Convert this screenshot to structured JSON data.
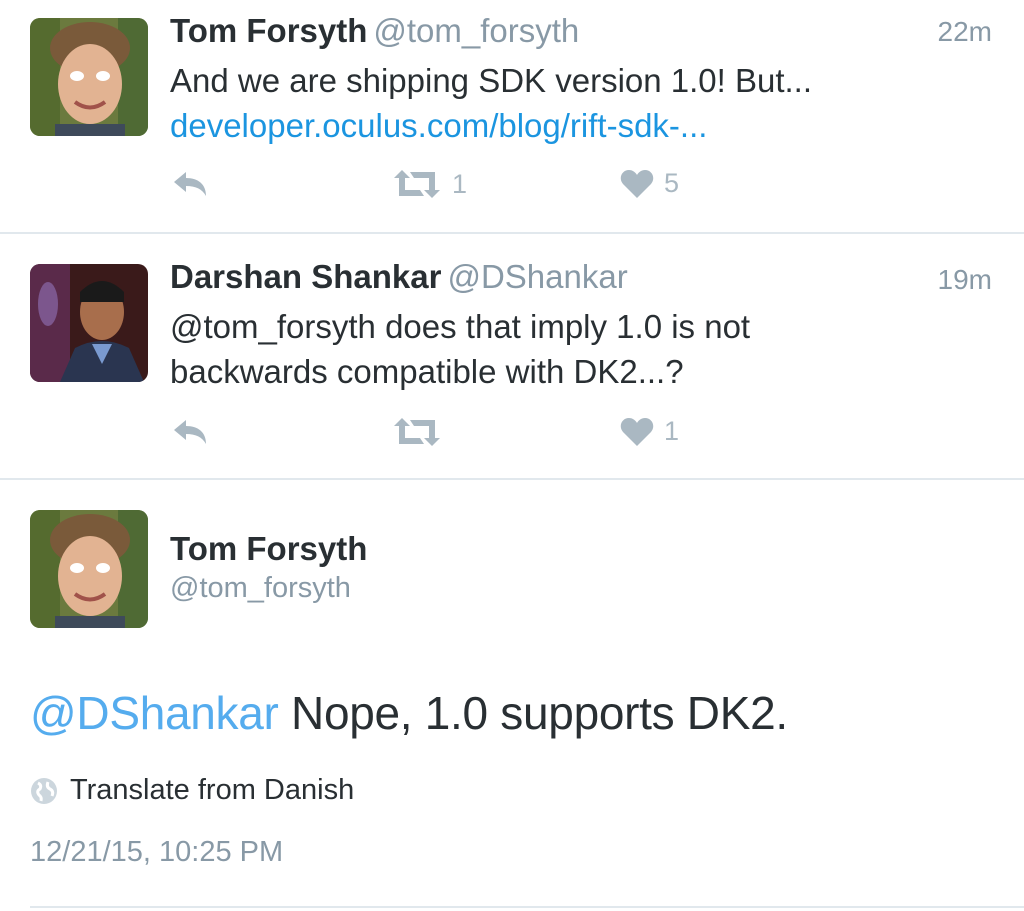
{
  "tweets": [
    {
      "name": "Tom Forsyth",
      "handle": "@tom_forsyth",
      "time": "22m",
      "text": "And we are shipping SDK version 1.0! But...",
      "link": "developer.oculus.com/blog/rift-sdk-...",
      "retweets": "1",
      "likes": "5",
      "avatar_icon": "person-photo"
    },
    {
      "name": "Darshan Shankar",
      "handle": "@DShankar",
      "time": "19m",
      "text_line1": "@tom_forsyth does that imply 1.0 is not",
      "text_line2": "backwards compatible with DK2...?",
      "retweets": "",
      "likes": "1",
      "avatar_icon": "person-photo"
    }
  ],
  "main_tweet": {
    "name": "Tom Forsyth",
    "handle": "@tom_forsyth",
    "mention": "@DShankar",
    "text": " Nope, 1.0 supports DK2.",
    "translate_label": "Translate from Danish",
    "timestamp": "12/21/15, 10:25 PM"
  },
  "colors": {
    "link": "#1b95e0",
    "mention": "#55acee",
    "muted": "#8899a6",
    "action_gray": "#aab8c2",
    "divider": "#e1e8ed"
  },
  "icons": [
    "reply-icon",
    "retweet-icon",
    "like-icon",
    "globe-icon"
  ]
}
